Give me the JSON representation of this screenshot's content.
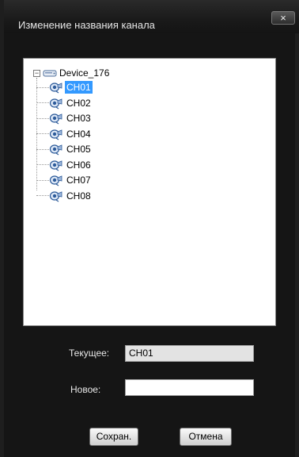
{
  "dialog": {
    "title": "Изменение названия канала",
    "close_label": "×"
  },
  "tree": {
    "root": {
      "label": "Device_176",
      "expander": "−"
    },
    "channels": [
      {
        "label": "CH01",
        "selected": true
      },
      {
        "label": "CH02",
        "selected": false
      },
      {
        "label": "CH03",
        "selected": false
      },
      {
        "label": "CH04",
        "selected": false
      },
      {
        "label": "CH05",
        "selected": false
      },
      {
        "label": "CH06",
        "selected": false
      },
      {
        "label": "CH07",
        "selected": false
      },
      {
        "label": "CH08",
        "selected": false
      }
    ]
  },
  "form": {
    "current_label": "Текущее:",
    "current_value": "CH01",
    "new_label": "Новое:",
    "new_value": ""
  },
  "buttons": {
    "save_label": "Сохран.",
    "cancel_label": "Отмена"
  },
  "colors": {
    "selection": "#3399ff",
    "background": "#151515"
  },
  "icons": {
    "device": "device-icon",
    "channel": "camera-icon"
  }
}
